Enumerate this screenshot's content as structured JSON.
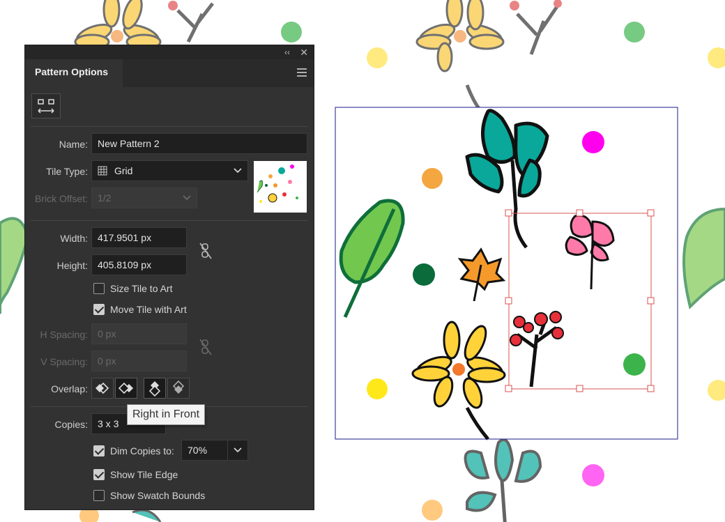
{
  "panel": {
    "title": "Pattern Options",
    "collapse_icon": "double-chevron-left-icon",
    "close_icon": "close-icon",
    "menu_icon": "panel-menu-icon",
    "tile_tool_icon": "pattern-tile-tool-icon",
    "name": {
      "label": "Name:",
      "value": "New Pattern 2"
    },
    "tile_type": {
      "label": "Tile Type:",
      "value": "Grid",
      "icon": "grid-icon"
    },
    "brick_offset": {
      "label": "Brick Offset:",
      "value": "1/2"
    },
    "width": {
      "label": "Width:",
      "value": "417.9501 px"
    },
    "height": {
      "label": "Height:",
      "value": "405.8109 px"
    },
    "link_icon": "broken-link-icon",
    "size_tile_to_art": {
      "label": "Size Tile to Art",
      "checked": false
    },
    "move_tile_with_art": {
      "label": "Move Tile with Art",
      "checked": true
    },
    "h_spacing": {
      "label": "H Spacing:",
      "value": "0 px"
    },
    "v_spacing": {
      "label": "V Spacing:",
      "value": "0 px"
    },
    "overlap": {
      "label": "Overlap:",
      "selected": "Right in Front"
    },
    "tooltip": "Right in Front",
    "copies": {
      "label": "Copies:",
      "value": "3 x 3"
    },
    "dim_copies": {
      "label": "Dim Copies to:",
      "value": "70%",
      "checked": true
    },
    "show_tile_edge": {
      "label": "Show Tile Edge",
      "checked": true
    },
    "show_swatch_bounds": {
      "label": "Show Swatch Bounds",
      "checked": false
    }
  },
  "colors": {
    "panel_bg": "#323232",
    "tile_edge": "#1a1a8c",
    "selection": "#d9534f"
  }
}
